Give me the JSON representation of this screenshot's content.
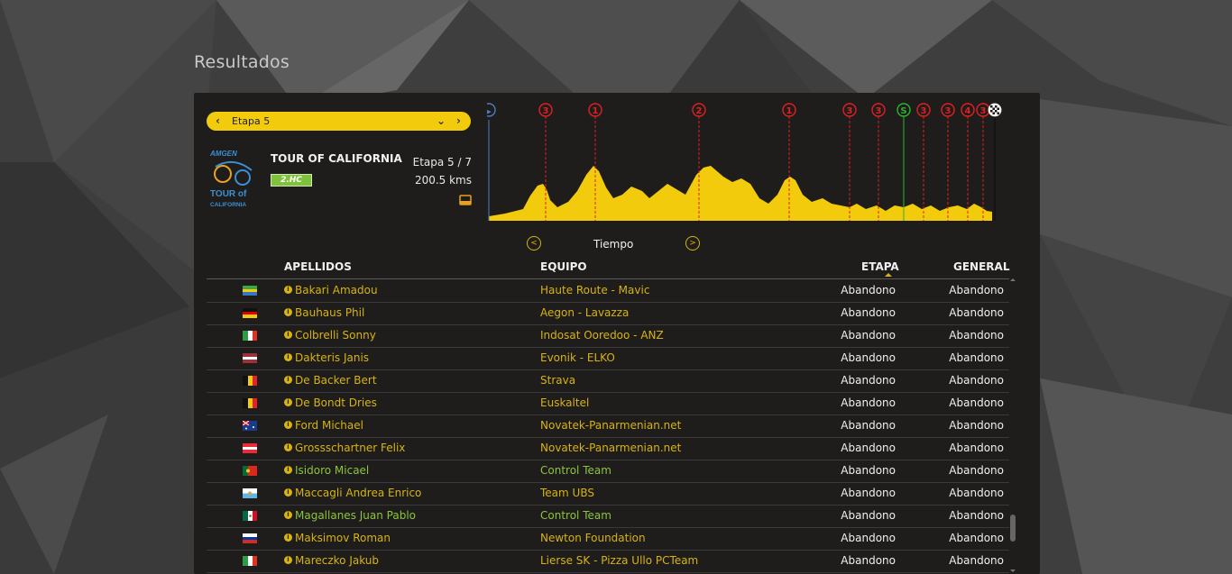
{
  "page": {
    "title": "Resultados"
  },
  "stage_selector": {
    "label": "Etapa 5",
    "prev_icon": "chevron-left-icon",
    "dropdown_icon": "chevron-down-icon",
    "next_icon": "chevron-right-icon"
  },
  "race": {
    "logo_text": [
      "AMGEN",
      "TOUR of",
      "CALIFORNIA"
    ],
    "name": "TOUR OF CALIFORNIA",
    "category": "2.HC",
    "stage_number": "Etapa 5 / 7",
    "distance": "200.5 kms",
    "stage_icon": "stage-type-icon"
  },
  "profile": {
    "markers": [
      {
        "label": "▶",
        "kind": "start"
      },
      {
        "label": "3",
        "kind": "climb"
      },
      {
        "label": "1",
        "kind": "climb"
      },
      {
        "label": "2",
        "kind": "climb"
      },
      {
        "label": "1",
        "kind": "climb"
      },
      {
        "label": "3",
        "kind": "climb"
      },
      {
        "label": "3",
        "kind": "climb"
      },
      {
        "label": "S",
        "kind": "sprint"
      },
      {
        "label": "3",
        "kind": "climb"
      },
      {
        "label": "3",
        "kind": "climb"
      },
      {
        "label": "4",
        "kind": "climb"
      },
      {
        "label": "3",
        "kind": "climb"
      },
      {
        "label": "",
        "kind": "finish"
      }
    ],
    "colors": {
      "fill": "#f2cc0c",
      "climb": "#e02020",
      "sprint": "#2bb52b",
      "start": "#4a7fc1"
    }
  },
  "results_nav": {
    "label": "Tiempo",
    "prev_icon": "circle-chevron-left-icon",
    "next_icon": "circle-chevron-right-icon"
  },
  "table": {
    "headers": {
      "rider": "APELLIDOS",
      "team": "EQUIPO",
      "stage": "ETAPA",
      "general": "GENERAL"
    },
    "rows": [
      {
        "flag": "gabon",
        "rider": "Bakari Amadou",
        "team": "Haute Route - Mavic",
        "stage": "Abandono",
        "general": "Abandono",
        "highlight": false
      },
      {
        "flag": "germany",
        "rider": "Bauhaus Phil",
        "team": "Aegon - Lavazza",
        "stage": "Abandono",
        "general": "Abandono",
        "highlight": false
      },
      {
        "flag": "italy",
        "rider": "Colbrelli Sonny",
        "team": "Indosat Ooredoo - ANZ",
        "stage": "Abandono",
        "general": "Abandono",
        "highlight": false
      },
      {
        "flag": "latvia",
        "rider": "Dakteris Janis",
        "team": "Evonik - ELKO",
        "stage": "Abandono",
        "general": "Abandono",
        "highlight": false
      },
      {
        "flag": "belgium",
        "rider": "De Backer Bert",
        "team": "Strava",
        "stage": "Abandono",
        "general": "Abandono",
        "highlight": false
      },
      {
        "flag": "belgium",
        "rider": "De Bondt Dries",
        "team": "Euskaltel",
        "stage": "Abandono",
        "general": "Abandono",
        "highlight": false
      },
      {
        "flag": "australia",
        "rider": "Ford Michael",
        "team": "Novatek-Panarmenian.net",
        "stage": "Abandono",
        "general": "Abandono",
        "highlight": false
      },
      {
        "flag": "austria",
        "rider": "Grossschartner Felix",
        "team": "Novatek-Panarmenian.net",
        "stage": "Abandono",
        "general": "Abandono",
        "highlight": false
      },
      {
        "flag": "portugal",
        "rider": "Isidoro Micael",
        "team": "Control Team",
        "stage": "Abandono",
        "general": "Abandono",
        "highlight": true
      },
      {
        "flag": "san-marino",
        "rider": "Maccagli Andrea Enrico",
        "team": "Team UBS",
        "stage": "Abandono",
        "general": "Abandono",
        "highlight": false
      },
      {
        "flag": "mexico",
        "rider": "Magallanes Juan Pablo",
        "team": "Control Team",
        "stage": "Abandono",
        "general": "Abandono",
        "highlight": true
      },
      {
        "flag": "russia",
        "rider": "Maksimov Roman",
        "team": "Newton Foundation",
        "stage": "Abandono",
        "general": "Abandono",
        "highlight": false
      },
      {
        "flag": "italy",
        "rider": "Mareczko Jakub",
        "team": "Lierse SK - Pizza Ullo PCTeam",
        "stage": "Abandono",
        "general": "Abandono",
        "highlight": false
      }
    ]
  },
  "colors": {
    "accent": "#d7b313",
    "highlight": "#8cc43c",
    "text": "#f0f0f0"
  }
}
